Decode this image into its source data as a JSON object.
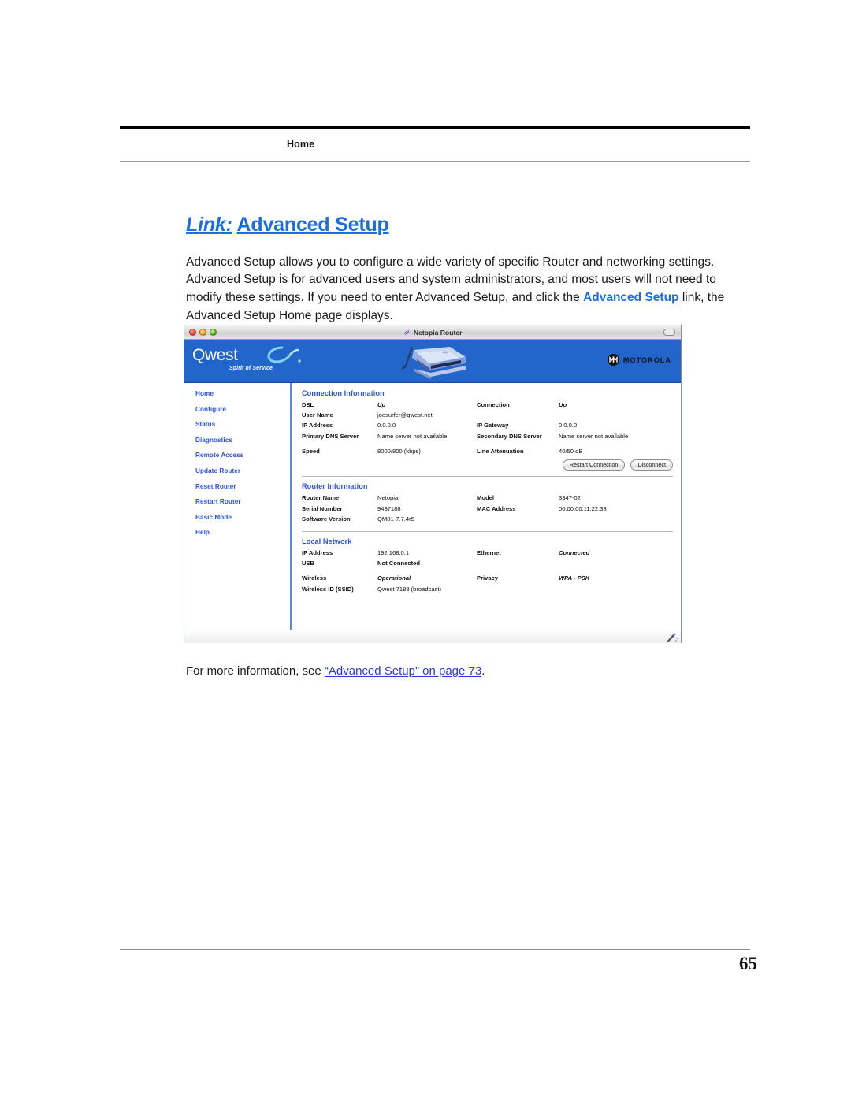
{
  "running_head": {
    "label": "Home"
  },
  "section": {
    "title_lead": "Link:",
    "title_rest": "Advanced Setup",
    "paragraph_part1": "Advanced Setup allows you to configure a wide variety of specific Router and networking settings. Advanced Setup is for advanced users and system administrators, and most users will not need to modify these settings. If you need to enter Advanced Setup, and click the ",
    "paragraph_link": "Advanced Setup",
    "paragraph_part2": " link, the Advanced Setup Home page displays."
  },
  "screenshot": {
    "window": {
      "title": "Netopia Router",
      "titlebar_icon": "netopia-feather-icon",
      "traffic_lights": [
        "close-button",
        "minimize-button",
        "zoom-button"
      ],
      "toolbar_pill": "toolbar-toggle-button"
    },
    "banner": {
      "brand": "Qwest",
      "tagline": "Spirit of Service",
      "device_image": "router-device-image",
      "partner_brand": "MOTOROLA",
      "banner_color": "#2266cc"
    },
    "sidebar": {
      "items": [
        {
          "label": "Home"
        },
        {
          "label": "Configure"
        },
        {
          "label": "Status"
        },
        {
          "label": "Diagnostics"
        },
        {
          "label": "Remote Access"
        },
        {
          "label": "Update Router"
        },
        {
          "label": "Reset Router"
        },
        {
          "label": "Restart Router"
        },
        {
          "label": "Basic Mode"
        },
        {
          "label": "Help"
        }
      ]
    },
    "connection_information": {
      "heading": "Connection Information",
      "rows": [
        {
          "k": "DSL",
          "v": "Up",
          "v_style": "blue",
          "k2": "Connection",
          "v2": "Up",
          "v2_style": "blue"
        },
        {
          "k": "User Name",
          "v": "joesurfer@qwest.net",
          "v_style": "plain",
          "k2": "",
          "v2": "",
          "v2_style": "plain"
        },
        {
          "k": "IP Address",
          "v": "0.0.0.0",
          "v_style": "plain",
          "k2": "IP Gateway",
          "v2": "0.0.0.0",
          "v2_style": "plain"
        },
        {
          "k": "Primary DNS Server",
          "v": "Name server not available",
          "v_style": "plain",
          "k2": "Secondary DNS Server",
          "v2": "Name server not available",
          "v2_style": "plain"
        },
        {
          "k": "Speed",
          "v": "8000/800 (kbps)",
          "v_style": "plain",
          "k2": "Line Attenuation",
          "v2": "40/50 dB",
          "v2_style": "plain"
        }
      ],
      "buttons": [
        {
          "label": "Restart Connection"
        },
        {
          "label": "Disconnect"
        }
      ]
    },
    "router_information": {
      "heading": "Router Information",
      "rows": [
        {
          "k": "Router Name",
          "v": "Netopia",
          "v_style": "plain",
          "k2": "Model",
          "v2": "3347-02",
          "v2_style": "plain"
        },
        {
          "k": "Serial Number",
          "v": "9437188",
          "v_style": "plain",
          "k2": "MAC Address",
          "v2": "00:00:00:11:22:33",
          "v2_style": "plain"
        },
        {
          "k": "Software Version",
          "v": "QM01-7.7.4r5",
          "v_style": "plain",
          "k2": "",
          "v2": "",
          "v2_style": "plain"
        }
      ]
    },
    "local_network": {
      "heading": "Local Network",
      "rows": [
        {
          "k": "IP Address",
          "v": "192.168.0.1",
          "v_style": "plain",
          "k2": "Ethernet",
          "v2": "Connected",
          "v2_style": "blue"
        },
        {
          "k": "USB",
          "v": "Not Connected",
          "v_style": "red",
          "k2": "",
          "v2": "",
          "v2_style": "plain"
        },
        {
          "k": "Wireless",
          "v": "Operational",
          "v_style": "blue",
          "k2": "Privacy",
          "v2": "WPA - PSK",
          "v2_style": "blue"
        },
        {
          "k": "Wireless ID (SSID)",
          "v": "Qwest 7188 (broadcast)",
          "v_style": "plain",
          "k2": "",
          "v2": "",
          "v2_style": "plain"
        }
      ]
    },
    "statusbar": {
      "resize_grip": "resize-grip-icon"
    }
  },
  "caption": {
    "prefix": "For more information, see ",
    "xref": "“Advanced Setup” on page 73",
    "suffix": "."
  },
  "footer": {
    "page_number": "65"
  }
}
